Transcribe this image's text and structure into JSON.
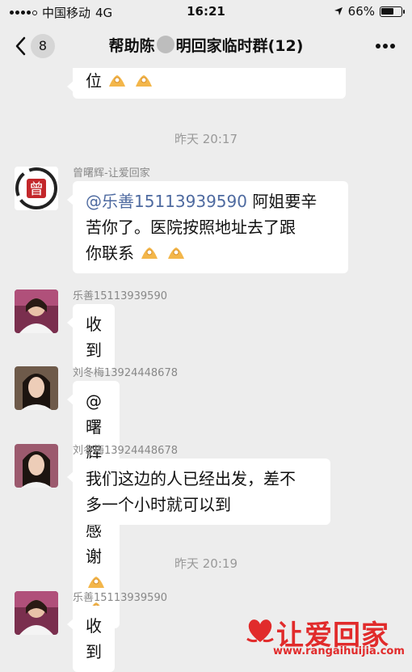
{
  "status_bar": {
    "carrier": "中国移动",
    "network": "4G",
    "time": "16:21",
    "battery_percent": "66%",
    "battery_level": 0.66
  },
  "header": {
    "back_count": "8",
    "title_prefix": "帮助陈",
    "title_suffix": "明回家临时群(12)"
  },
  "messages": [
    {
      "text": "位"
    },
    {
      "timestamp": "昨天 20:17"
    },
    {
      "sender": "曾曙辉-让爱回家",
      "avatar_char": "曾",
      "mention": "@乐善15113939590",
      "line1_rest": " 阿姐要辛",
      "line2": "苦你了。医院按照地址去了跟",
      "line3": "你联系"
    },
    {
      "sender": "乐善15113939590",
      "text": "收到"
    },
    {
      "sender": "刘冬梅13924448678",
      "text": "@曙辉 感谢感谢"
    },
    {
      "sender": "刘冬梅13924448678",
      "line1": "我们这边的人已经出发，差不",
      "line2": "多一个小时就可以到"
    },
    {
      "timestamp": "昨天 20:19"
    },
    {
      "sender": "乐善15113939590",
      "text": "收到"
    }
  ],
  "watermark": {
    "title": "让爱回家",
    "url": "www.rangaihuijia.com"
  },
  "colors": {
    "background": "#ededed",
    "mention": "#4e6aa0",
    "watermark": "#e12b2b"
  }
}
